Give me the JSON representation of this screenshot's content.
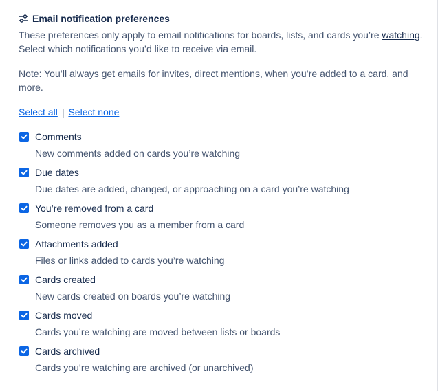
{
  "header": {
    "icon": "sliders-icon",
    "title": "Email notification preferences"
  },
  "description": {
    "before_link": "These preferences only apply to email notifications for boards, lists, and cards you’re ",
    "link": "watching",
    "after_link": ". Select which notifications you’d like to receive via email."
  },
  "note": "Note: You’ll always get emails for invites, direct mentions, when you’re added to a card, and more.",
  "select": {
    "all_label": "Select all",
    "separator": "|",
    "none_label": "Select none"
  },
  "options": [
    {
      "label": "Comments",
      "description": "New comments added on cards you’re watching",
      "checked": true
    },
    {
      "label": "Due dates",
      "description": "Due dates are added, changed, or approaching on a card you’re watching",
      "checked": true
    },
    {
      "label": "You’re removed from a card",
      "description": "Someone removes you as a member from a card",
      "checked": true
    },
    {
      "label": "Attachments added",
      "description": "Files or links added to cards you’re watching",
      "checked": true
    },
    {
      "label": "Cards created",
      "description": "New cards created on boards you’re watching",
      "checked": true
    },
    {
      "label": "Cards moved",
      "description": "Cards you’re watching are moved between lists or boards",
      "checked": true
    },
    {
      "label": "Cards archived",
      "description": "Cards you’re watching are archived (or unarchived)",
      "checked": true
    }
  ],
  "colors": {
    "checkbox": "#0c66e4",
    "heading": "#172b4d",
    "body_text": "#44546f",
    "link": "#0c66e4"
  }
}
